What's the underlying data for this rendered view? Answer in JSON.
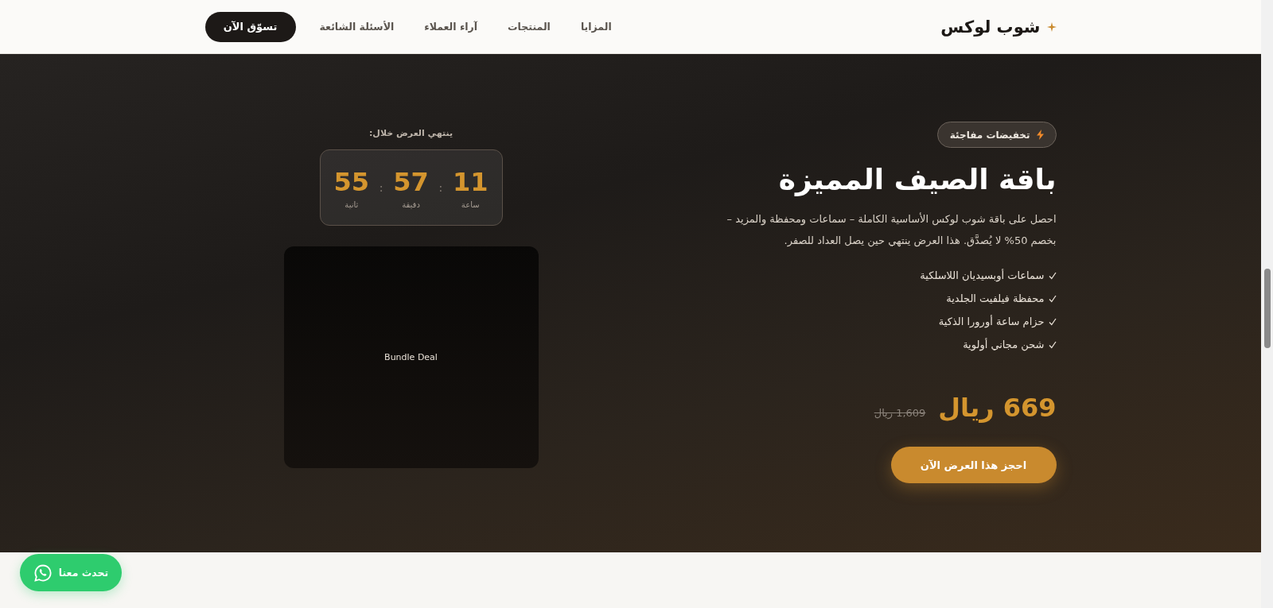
{
  "header": {
    "logo": "شوب لوكس",
    "nav": [
      "المزايا",
      "المنتجات",
      "آراء العملاء",
      "الأسئلة الشائعة"
    ],
    "cta": "تسوّق الآن"
  },
  "hero": {
    "badge": "تخفيضات مفاجئة",
    "title": "باقة الصيف المميزة",
    "description": "احصل على باقة شوب لوكس الأساسية الكاملة – سماعات ومحفظة والمزيد – بخصم 50% لا يُصدَّق. هذا العرض ينتهي حين يصل العداد للصفر.",
    "features": [
      "سماعات أوبسيديان اللاسلكية",
      "محفظة فيلفيت الجلدية",
      "حزام ساعة أورورا الذكية",
      "شحن مجاني أولوية"
    ],
    "price": {
      "current": "669 ريال",
      "original": "1,609 ريال"
    },
    "cta": "احجز هذا العرض الآن",
    "countdown": {
      "label": "ينتهي العرض خلال:",
      "separator": ":",
      "units": [
        {
          "value": "11",
          "label": "ساعة"
        },
        {
          "value": "57",
          "label": "دقيقة"
        },
        {
          "value": "55",
          "label": "ثانية"
        }
      ]
    },
    "media": {
      "caption": "Bundle Deal"
    }
  },
  "chat": {
    "label": "تحدث معنا"
  }
}
